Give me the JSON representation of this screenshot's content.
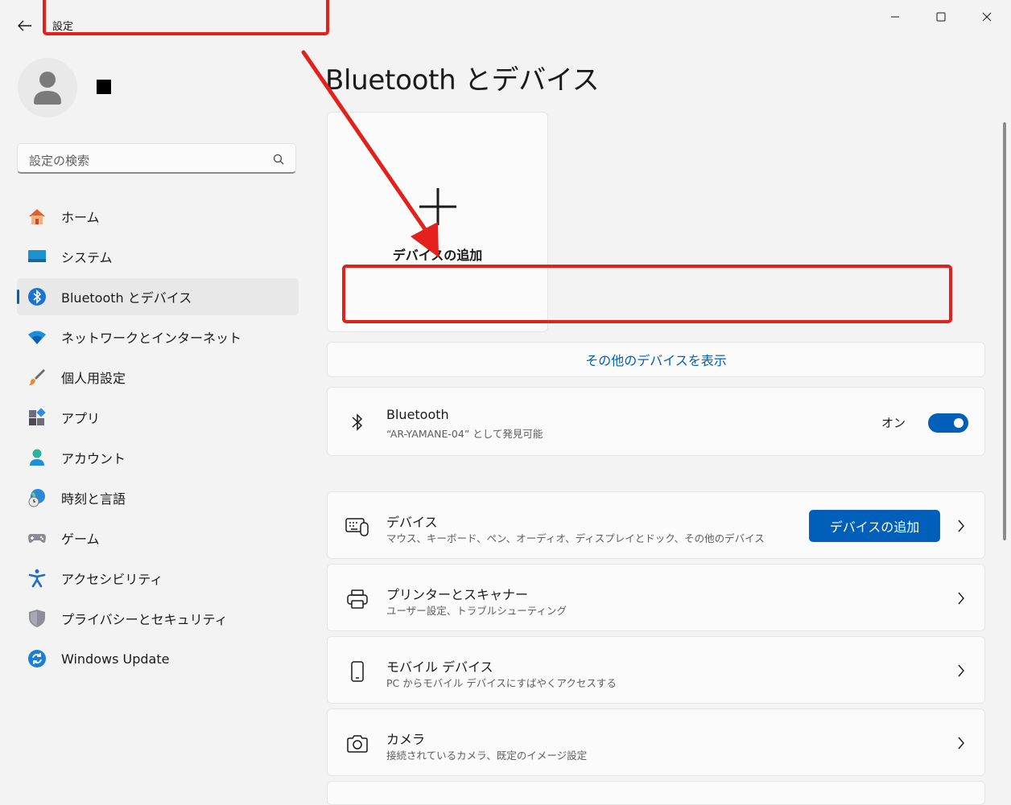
{
  "window": {
    "title": "設定"
  },
  "user": {
    "name_glyph": "■"
  },
  "search": {
    "placeholder": "設定の検索"
  },
  "sidebar": {
    "items": [
      {
        "label": "ホーム",
        "icon": "home-icon"
      },
      {
        "label": "システム",
        "icon": "monitor-icon"
      },
      {
        "label": "Bluetooth とデバイス",
        "icon": "bluetooth-icon",
        "selected": true
      },
      {
        "label": "ネットワークとインターネット",
        "icon": "wifi-icon"
      },
      {
        "label": "個人用設定",
        "icon": "brush-icon"
      },
      {
        "label": "アプリ",
        "icon": "apps-icon"
      },
      {
        "label": "アカウント",
        "icon": "person-icon"
      },
      {
        "label": "時刻と言語",
        "icon": "globe-clock-icon"
      },
      {
        "label": "ゲーム",
        "icon": "gamepad-icon"
      },
      {
        "label": "アクセシビリティ",
        "icon": "accessibility-icon"
      },
      {
        "label": "プライバシーとセキュリティ",
        "icon": "shield-icon"
      },
      {
        "label": "Windows Update",
        "icon": "refresh-icon"
      }
    ]
  },
  "main": {
    "title": "Bluetooth とデバイス",
    "add_tile_label": "デバイスの追加",
    "show_more": "その他のデバイスを表示",
    "bluetooth": {
      "title": "Bluetooth",
      "subtitle": "“AR-YAMANE-04” として発見可能",
      "toggle_label": "オン",
      "toggle_on": true
    },
    "cards": [
      {
        "title": "デバイス",
        "subtitle": "マウス、キーボード、ペン、オーディオ、ディスプレイとドック、その他のデバイス",
        "icon": "keyboard-mouse-icon",
        "button": "デバイスの追加"
      },
      {
        "title": "プリンターとスキャナー",
        "subtitle": "ユーザー設定、トラブルシューティング",
        "icon": "printer-icon"
      },
      {
        "title": "モバイル デバイス",
        "subtitle": "PC からモバイル デバイスにすばやくアクセスする",
        "icon": "phone-icon"
      },
      {
        "title": "カメラ",
        "subtitle": "接続されているカメラ、既定のイメージ設定",
        "icon": "camera-icon"
      }
    ]
  },
  "colors": {
    "accent": "#005fb8",
    "annotation": "#e3201b",
    "background": "#f3f3f3"
  }
}
